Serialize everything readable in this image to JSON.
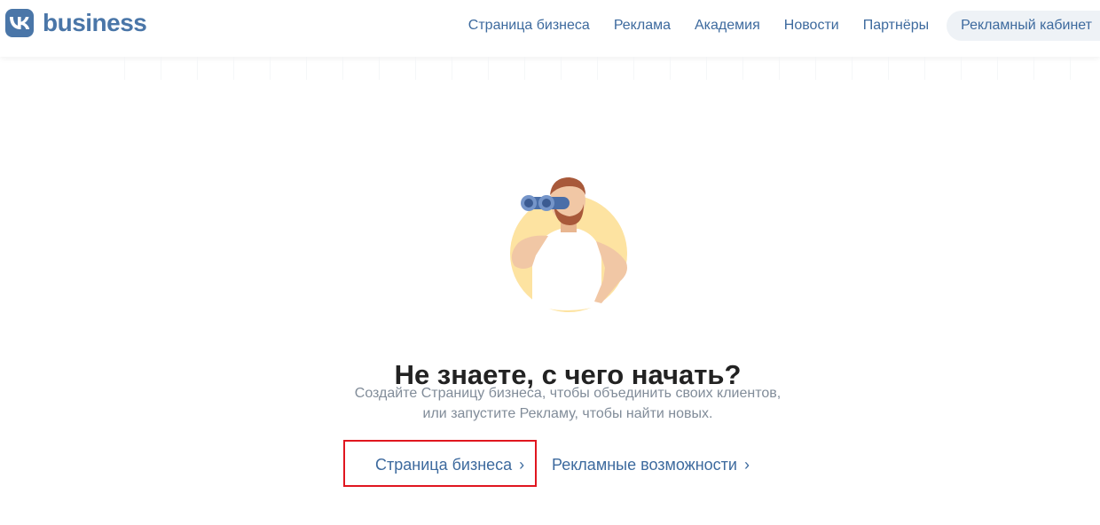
{
  "header": {
    "logo_text": "business",
    "nav": [
      {
        "label": "Страница бизнеса"
      },
      {
        "label": "Реклама"
      },
      {
        "label": "Академия"
      },
      {
        "label": "Новости"
      },
      {
        "label": "Партнёры"
      },
      {
        "label": "Рекламный кабинет"
      }
    ]
  },
  "main": {
    "heading": "Не знаете, с чего начать?",
    "description_line1": "Создайте Страницу бизнеса, чтобы объединить своих клиентов,",
    "description_line2": "или запустите Рекламу, чтобы найти новых.",
    "cta_page_label": "Страница бизнеса",
    "cta_ads_label": "Рекламные возможности",
    "chevron": "›"
  },
  "colors": {
    "brand": "#4a76a8",
    "link": "#3d6a9e",
    "highlight": "#e0161f"
  }
}
